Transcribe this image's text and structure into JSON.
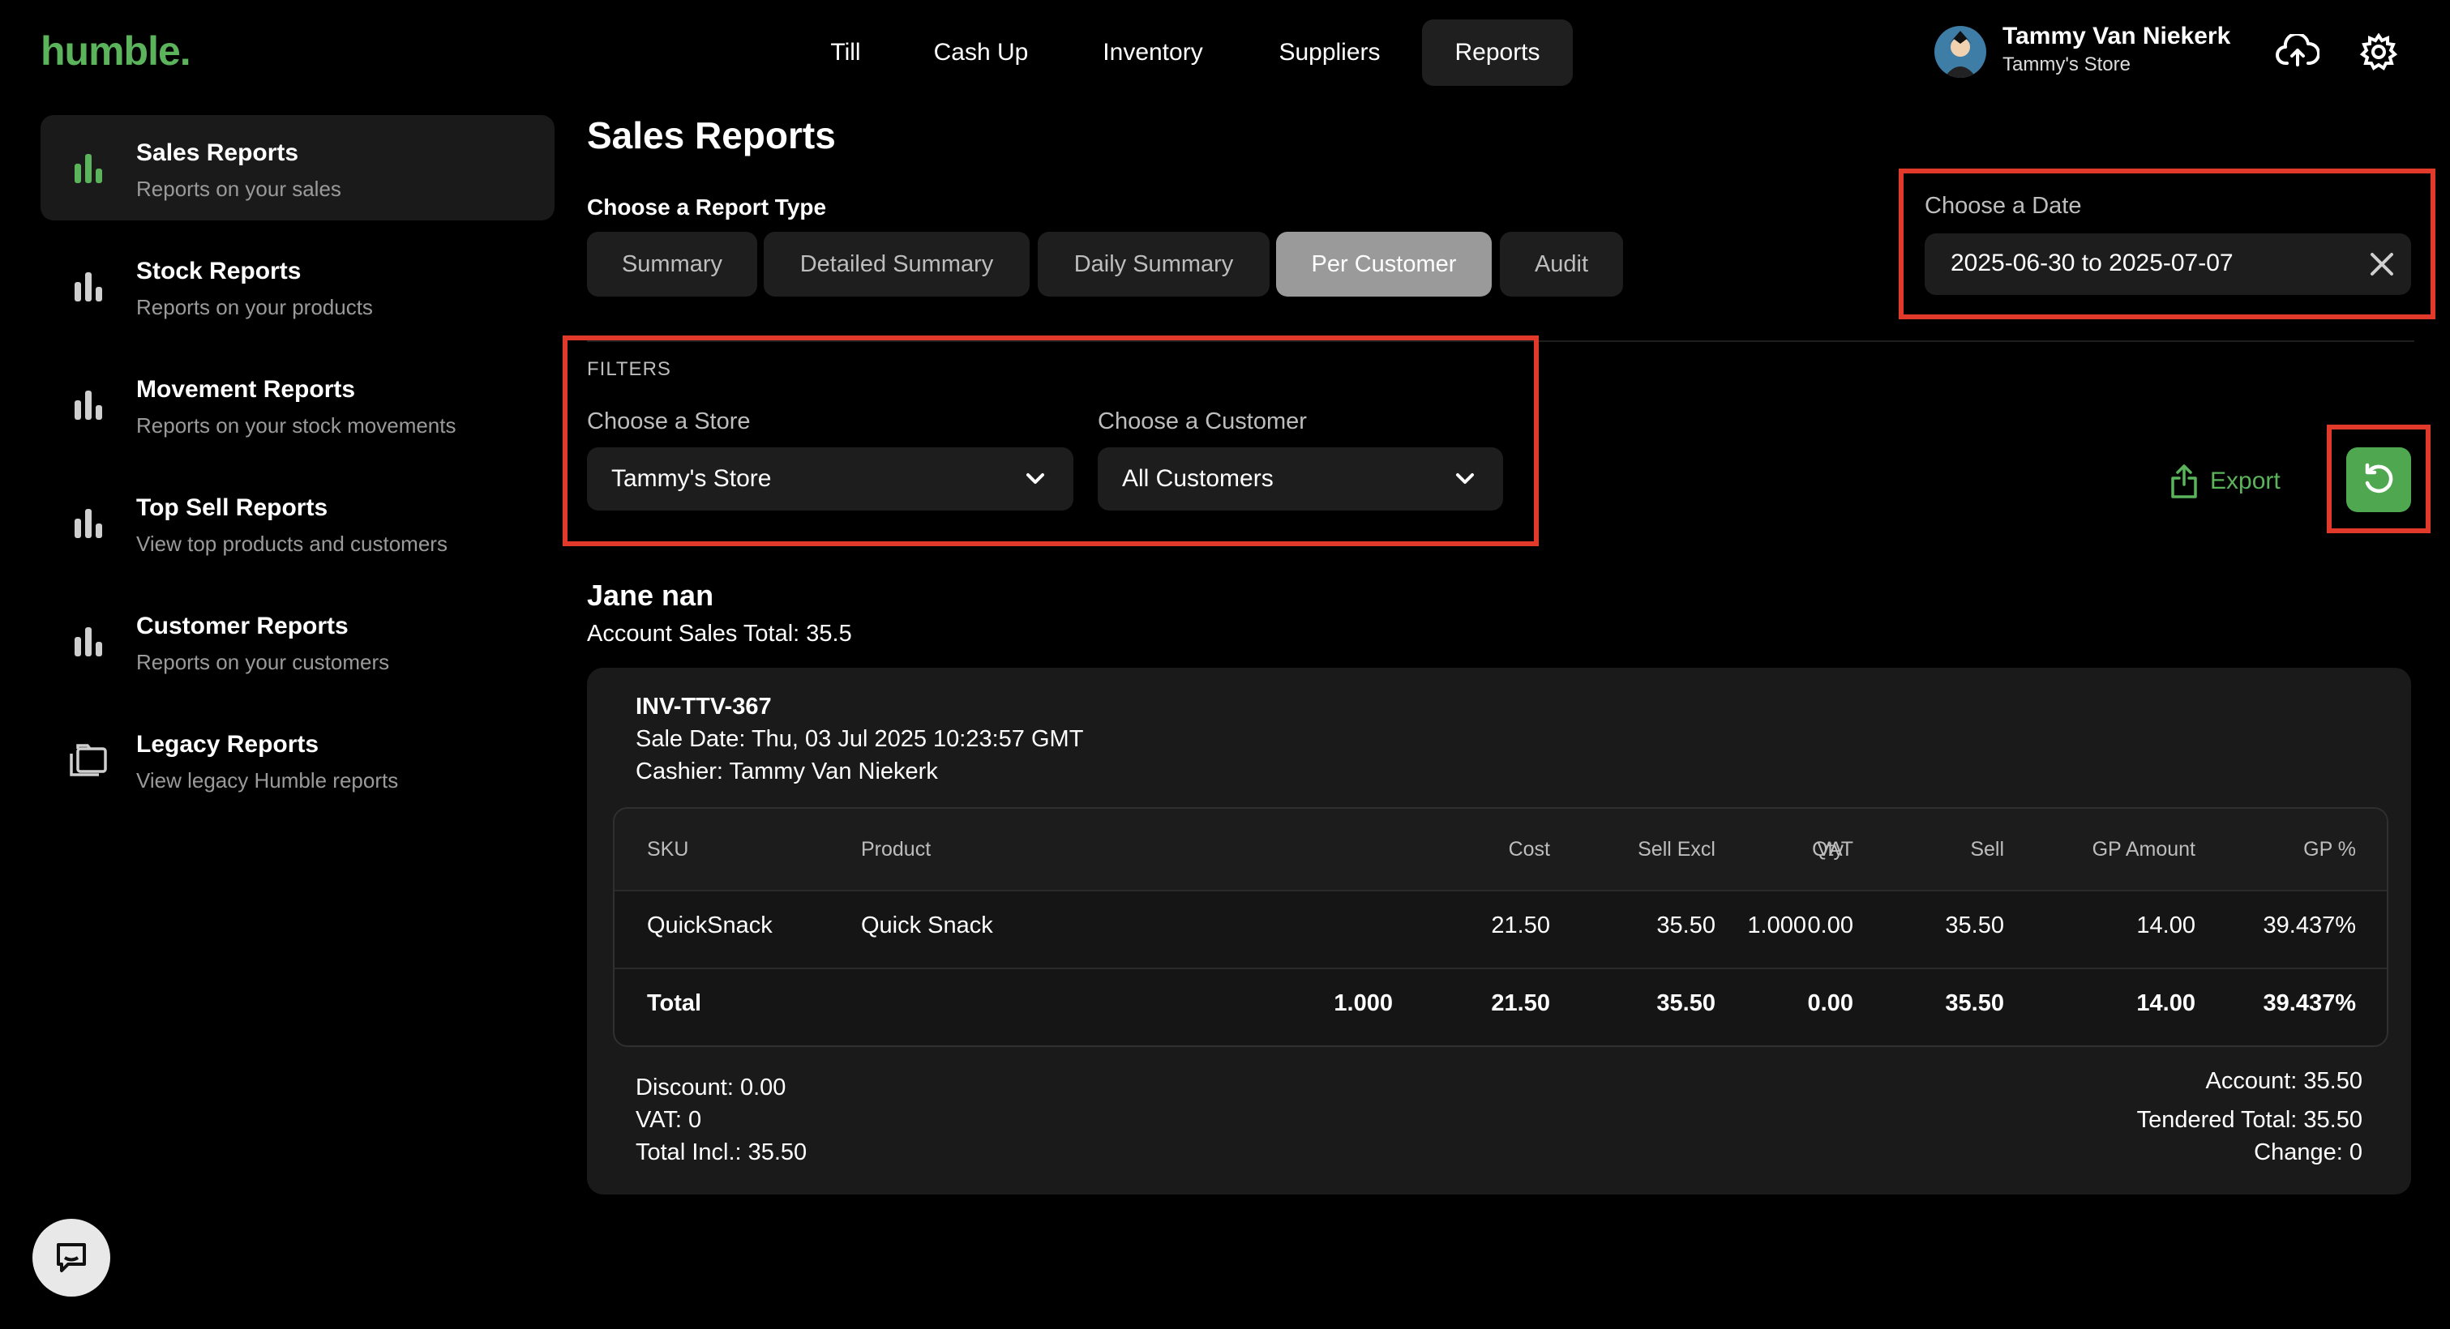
{
  "app": {
    "logo": "humble."
  },
  "nav": {
    "items": [
      {
        "label": "Till"
      },
      {
        "label": "Cash Up"
      },
      {
        "label": "Inventory"
      },
      {
        "label": "Suppliers"
      },
      {
        "label": "Reports",
        "active": true
      }
    ]
  },
  "user": {
    "name": "Tammy Van Niekerk",
    "store": "Tammy's Store"
  },
  "sidebar": {
    "items": [
      {
        "title": "Sales Reports",
        "subtitle": "Reports on your sales",
        "icon": "bar-chart-icon",
        "active": true
      },
      {
        "title": "Stock Reports",
        "subtitle": "Reports on your products",
        "icon": "bar-chart-icon"
      },
      {
        "title": "Movement Reports",
        "subtitle": "Reports on your stock movements",
        "icon": "bar-chart-icon"
      },
      {
        "title": "Top Sell Reports",
        "subtitle": "View top products and customers",
        "icon": "bar-chart-icon"
      },
      {
        "title": "Customer Reports",
        "subtitle": "Reports on your customers",
        "icon": "bar-chart-icon"
      },
      {
        "title": "Legacy Reports",
        "subtitle": "View legacy Humble reports",
        "icon": "folders-icon"
      }
    ]
  },
  "main": {
    "title": "Sales Reports",
    "report_type_label": "Choose a Report Type",
    "report_types": [
      {
        "label": "Summary"
      },
      {
        "label": "Detailed Summary"
      },
      {
        "label": "Daily Summary"
      },
      {
        "label": "Per Customer",
        "active": true
      },
      {
        "label": "Audit"
      }
    ],
    "date": {
      "label": "Choose a Date",
      "value": "2025-06-30 to 2025-07-07"
    },
    "filters": {
      "caption": "FILTERS",
      "store_label": "Choose a Store",
      "store_value": "Tammy's Store",
      "customer_label": "Choose a Customer",
      "customer_value": "All Customers"
    },
    "export_label": "Export"
  },
  "report": {
    "customer_name": "Jane nan",
    "account_sales_total": "Account Sales Total: 35.5",
    "invoice": {
      "number": "INV-TTV-367",
      "sale_date": "Sale Date: Thu, 03 Jul 2025 10:23:57 GMT",
      "cashier": "Cashier: Tammy Van Niekerk",
      "columns": [
        "SKU",
        "Product",
        "Qty",
        "Cost",
        "Sell Excl",
        "VAT",
        "Sell",
        "GP Amount",
        "GP %"
      ],
      "row": {
        "sku": "QuickSnack",
        "product": "Quick Snack",
        "qty": "1.000",
        "cost": "21.50",
        "sell_excl": "35.50",
        "vat": "0.00",
        "sell": "35.50",
        "gp_amount": "14.00",
        "gp_pct": "39.437%"
      },
      "total": {
        "label": "Total",
        "qty": "1.000",
        "cost": "21.50",
        "sell_excl": "35.50",
        "vat": "0.00",
        "sell": "35.50",
        "gp_amount": "14.00",
        "gp_pct": "39.437%"
      },
      "discount": "Discount: 0.00",
      "vat": "VAT: 0",
      "total_incl": "Total Incl.: 35.50",
      "account": "Account: 35.50",
      "tendered_total": "Tendered Total: 35.50",
      "change": "Change: 0"
    }
  },
  "colors": {
    "accent": "#5bb35b",
    "highlight": "#e1392a",
    "background": "#000000",
    "card": "#1a1a1a"
  }
}
